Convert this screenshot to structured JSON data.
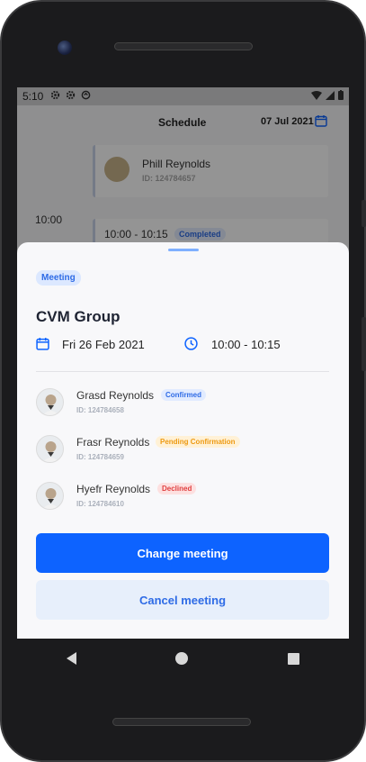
{
  "status_bar": {
    "time": "5:10"
  },
  "background": {
    "header_title": "Schedule",
    "header_date": "07 Jul 2021",
    "card1_name": "Phill Reynolds",
    "card1_id": "ID: 124784657",
    "time_label": "10:00",
    "card2_slot": "10:00 - 10:15",
    "card2_badge": "Completed"
  },
  "sheet": {
    "type_chip": "Meeting",
    "title": "CVM Group",
    "date": "Fri 26 Feb 2021",
    "time": "10:00 - 10:15",
    "attendees": [
      {
        "name": "Grasd Reynolds",
        "id": "ID: 124784658",
        "status": "Confirmed"
      },
      {
        "name": "Frasr Reynolds",
        "id": "ID: 124784659",
        "status": "Pending Confirmation"
      },
      {
        "name": "Hyefr Reynolds",
        "id": "ID: 124784610",
        "status": "Declined"
      }
    ],
    "primary_button": "Change meeting",
    "secondary_button": "Cancel meeting"
  },
  "colors": {
    "accent": "#0d63ff",
    "confirmed": "#2e6be6",
    "pending": "#ee9a12",
    "declined": "#e04040"
  }
}
